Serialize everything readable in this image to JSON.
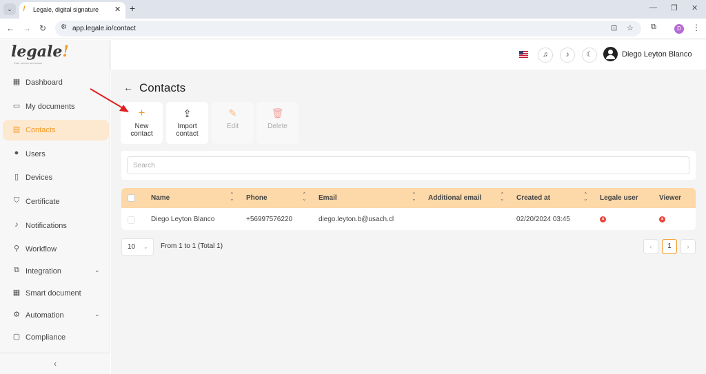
{
  "browser": {
    "tab_title": "Legale, digital signature",
    "tab_list_icon": "chevron-down-icon",
    "url": "app.legale.io/contact",
    "profile_initial": "D"
  },
  "sidebar": {
    "logo_text": "legale",
    "logo_mark": "!",
    "logo_tagline": "Fast, secure and smart",
    "items": [
      {
        "label": "Dashboard",
        "icon": "dashboard-icon",
        "active": false
      },
      {
        "label": "My documents",
        "icon": "folder-icon",
        "active": false
      },
      {
        "label": "Contacts",
        "icon": "contacts-icon",
        "active": true
      },
      {
        "label": "Users",
        "icon": "user-icon",
        "active": false
      },
      {
        "label": "Devices",
        "icon": "device-icon",
        "active": false
      },
      {
        "label": "Certificate",
        "icon": "shield-icon",
        "active": false
      },
      {
        "label": "Notifications",
        "icon": "bell-icon",
        "active": false
      },
      {
        "label": "Workflow",
        "icon": "workflow-icon",
        "active": false
      },
      {
        "label": "Integration",
        "icon": "external-link-icon",
        "active": false,
        "expandable": true
      },
      {
        "label": "Smart document",
        "icon": "smart-document-icon",
        "active": false
      },
      {
        "label": "Automation",
        "icon": "gear-icon",
        "active": false,
        "expandable": true
      },
      {
        "label": "Compliance",
        "icon": "chat-icon",
        "active": false
      }
    ],
    "collapse_glyph": "‹"
  },
  "header": {
    "user_name": "Diego Leyton Blanco"
  },
  "page": {
    "title": "Contacts",
    "actions": [
      {
        "label": "New contact",
        "icon": "plus-icon",
        "enabled": true
      },
      {
        "label": "Import contact",
        "icon": "upload-icon",
        "enabled": true
      },
      {
        "label": "Edit",
        "icon": "pencil-icon",
        "enabled": false
      },
      {
        "label": "Delete",
        "icon": "trash-icon",
        "enabled": false
      }
    ],
    "search_placeholder": "Search"
  },
  "table": {
    "columns": [
      "Name",
      "Phone",
      "Email",
      "Additional email",
      "Created at",
      "Legale user",
      "Viewer"
    ],
    "rows": [
      {
        "name": "Diego Leyton Blanco",
        "phone": "+56997576220",
        "email": "diego.leyton.b@usach.cl",
        "additional_email": "",
        "created_at": "02/20/2024 03:45",
        "legale_user": false,
        "viewer": false
      }
    ]
  },
  "pagination": {
    "page_size": "10",
    "range_text": "From 1 to 1 (Total 1)",
    "current_page": "1"
  },
  "colors": {
    "accent": "#f59a23",
    "table_header": "#fdd8a8",
    "error": "#e8433a",
    "annotation_arrow": "#e02020"
  }
}
